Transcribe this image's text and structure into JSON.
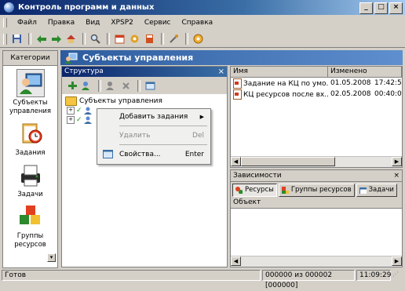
{
  "window": {
    "title": "Контроль программ и данных",
    "minimize": "_",
    "maximize": "□",
    "close": "×"
  },
  "menu": [
    "Файл",
    "Правка",
    "Вид",
    "XPSP2",
    "Сервис",
    "Справка"
  ],
  "categories": {
    "header": "Категории",
    "items": [
      {
        "label": "Субъекты управления",
        "icon": "user-monitor-icon",
        "selected": true
      },
      {
        "label": "Задания",
        "icon": "clock-clipboard-icon",
        "selected": false
      },
      {
        "label": "Задачи",
        "icon": "printer-stack-icon",
        "selected": false
      },
      {
        "label": "Группы ресурсов",
        "icon": "cubes-icon",
        "selected": false
      }
    ]
  },
  "main": {
    "title": "Субъекты управления"
  },
  "structure": {
    "header": "Структура",
    "close": "×",
    "tree_root": "Субъекты управления",
    "tree_child_1": "",
    "tree_child_2": ""
  },
  "context_menu": {
    "add_tasks": "Добавить задания",
    "delete": "Удалить",
    "delete_shortcut": "Del",
    "properties": "Свойства...",
    "properties_shortcut": "Enter"
  },
  "list": {
    "columns": [
      "Имя",
      "Изменено"
    ],
    "rows": [
      {
        "name": "Задание на КЦ по умо...",
        "date": "01.05.2008",
        "time": "17:42:5"
      },
      {
        "name": "КЦ ресурсов после вх...",
        "date": "02.05.2008",
        "time": "00:40:0"
      }
    ]
  },
  "dependencies": {
    "header": "Зависимости",
    "close": "×",
    "tabs": [
      "Ресурсы",
      "Группы ресурсов",
      "Задачи"
    ],
    "column": "Объект"
  },
  "status": {
    "text": "Готов",
    "counter": "000000 из 000002 [000000]",
    "time": "11:09:29"
  },
  "colors": {
    "title_bar": "#0a246a",
    "panel_header": "#2d5c9e",
    "accent": "#3a6ea5"
  }
}
